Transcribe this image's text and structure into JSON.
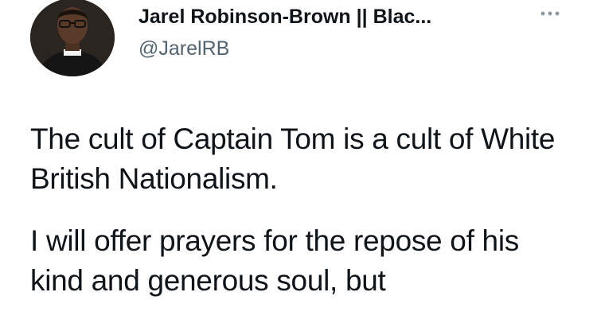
{
  "tweet": {
    "author": {
      "display_name": "Jarel Robinson-Brown || Blac...",
      "handle": "@JarelRB"
    },
    "more_icon": "more-horizontal-icon",
    "paragraphs": [
      "The cult of Captain Tom is a cult of White British Nationalism.",
      "I will offer prayers for the repose of his kind and generous soul, but"
    ]
  }
}
